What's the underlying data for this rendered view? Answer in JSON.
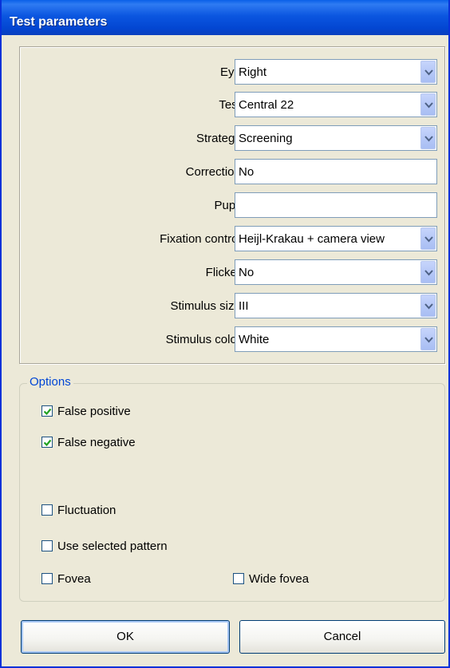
{
  "window": {
    "title": "Test parameters"
  },
  "params": [
    {
      "key": "eye",
      "label": "Eye:",
      "value": "Right",
      "kind": "select"
    },
    {
      "key": "test",
      "label": "Test:",
      "value": "Central 22",
      "kind": "select"
    },
    {
      "key": "strategy",
      "label": "Strategy:",
      "value": "Screening",
      "kind": "select"
    },
    {
      "key": "correction",
      "label": "Correction:",
      "value": "No",
      "kind": "text"
    },
    {
      "key": "pupil",
      "label": "Pupil:",
      "value": "",
      "kind": "text"
    },
    {
      "key": "fixation",
      "label": "Fixation control:",
      "value": "Heijl-Krakau + camera view",
      "kind": "select"
    },
    {
      "key": "flicker",
      "label": "Flicker:",
      "value": "No",
      "kind": "select"
    },
    {
      "key": "stimulus-size",
      "label": "Stimulus size:",
      "value": "III",
      "kind": "select"
    },
    {
      "key": "stimulus-color",
      "label": "Stimulus color:",
      "value": "White",
      "kind": "select"
    }
  ],
  "options": {
    "legend": "Options",
    "false_positive": {
      "label": "False positive",
      "checked": true
    },
    "false_negative": {
      "label": "False negative",
      "checked": true
    },
    "fluctuation": {
      "label": "Fluctuation",
      "checked": false
    },
    "use_selected_pattern": {
      "label": "Use selected pattern",
      "checked": false
    },
    "fovea": {
      "label": "Fovea",
      "checked": false
    },
    "wide_fovea": {
      "label": "Wide fovea",
      "checked": false
    }
  },
  "buttons": {
    "ok": "OK",
    "cancel": "Cancel"
  },
  "colors": {
    "titlebar": "#0346d2",
    "dialog_bg": "#ece9d8",
    "legend_text": "#0046d5",
    "check": "#21a121"
  }
}
